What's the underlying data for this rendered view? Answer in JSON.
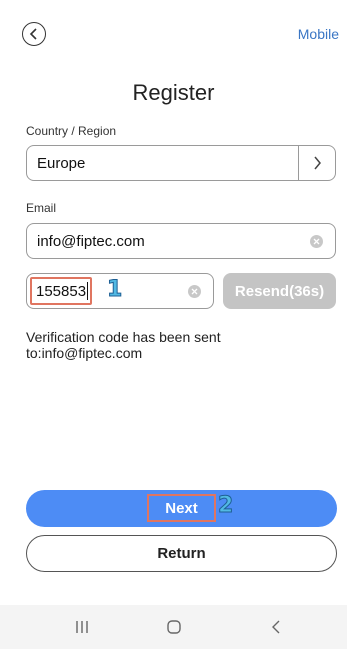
{
  "header": {
    "back_icon": "chevron-left-icon",
    "mobile_link": "Mobile"
  },
  "page_title": "Register",
  "country": {
    "label": "Country / Region",
    "value": "Europe",
    "arrow_icon": "chevron-right-icon"
  },
  "email": {
    "label": "Email",
    "value": "info@fiptec.com",
    "clear_icon": "clear-icon"
  },
  "verification": {
    "code_value": "155853",
    "annotation_number": "1",
    "resend_label": "Resend(36s)",
    "sent_message": "Verification code has been sent to:info@fiptec.com"
  },
  "actions": {
    "next_label": "Next",
    "next_annotation_number": "2",
    "return_label": "Return"
  },
  "navbar": {
    "recents_icon": "recents-icon",
    "home_icon": "home-icon",
    "back_icon": "back-icon"
  },
  "colors": {
    "primary_button": "#4d8cf5",
    "link": "#3a76c4",
    "disabled_button": "#c4c4c4",
    "highlight_box": "#e07560",
    "annotation_number": "#52b9e3"
  }
}
